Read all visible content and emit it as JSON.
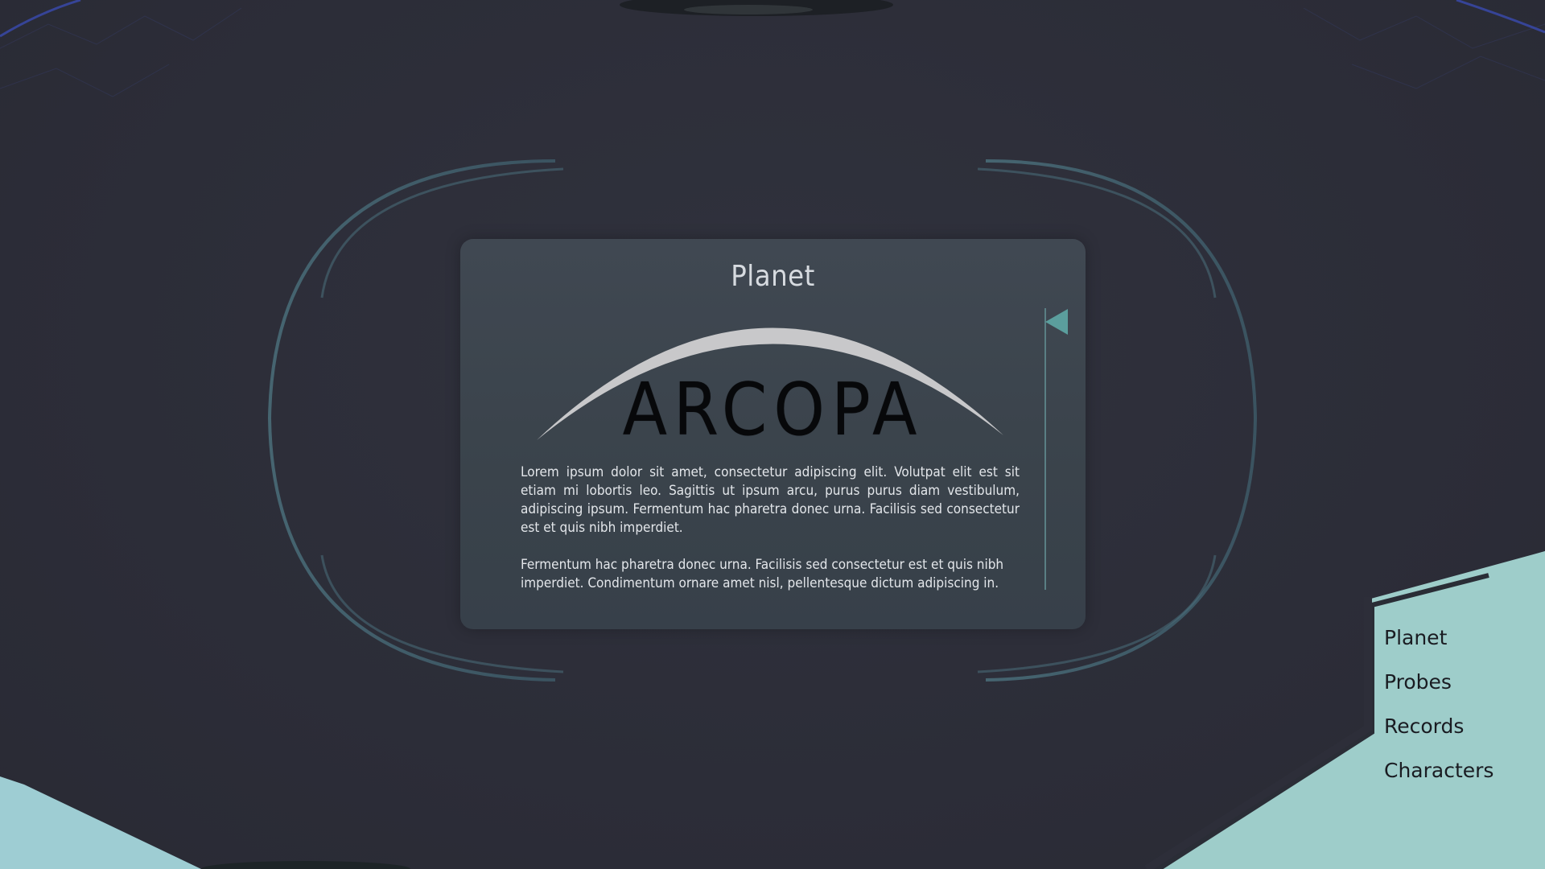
{
  "card": {
    "title": "Planet",
    "planet_name": "ARCOPA",
    "paragraph_1": "Lorem ipsum dolor sit amet, consectetur adipiscing elit. Volutpat elit est sit etiam mi lobortis leo. Sagittis ut ipsum arcu, purus purus diam vestibulum, adipiscing ipsum. Fermentum hac pharetra donec urna. Facilisis sed consectetur est et quis nibh imperdiet.",
    "paragraph_2": "Fermentum hac pharetra donec urna. Facilisis sed consectetur est et quis nibh imperdiet. Condimentum ornare amet nisl, pellentesque dictum adipiscing in.",
    "marker_icon": "triangle-left-icon"
  },
  "nav": {
    "items": [
      {
        "label": "Planet"
      },
      {
        "label": "Probes"
      },
      {
        "label": "Records"
      },
      {
        "label": "Characters"
      }
    ]
  },
  "colors": {
    "background": "#2d2e39",
    "card": "#3c444d",
    "accent_teal": "#5b9e9d",
    "nav_panel": "#9ecdca",
    "arc": "#c9c9cb",
    "ring": "#4a6a78"
  }
}
